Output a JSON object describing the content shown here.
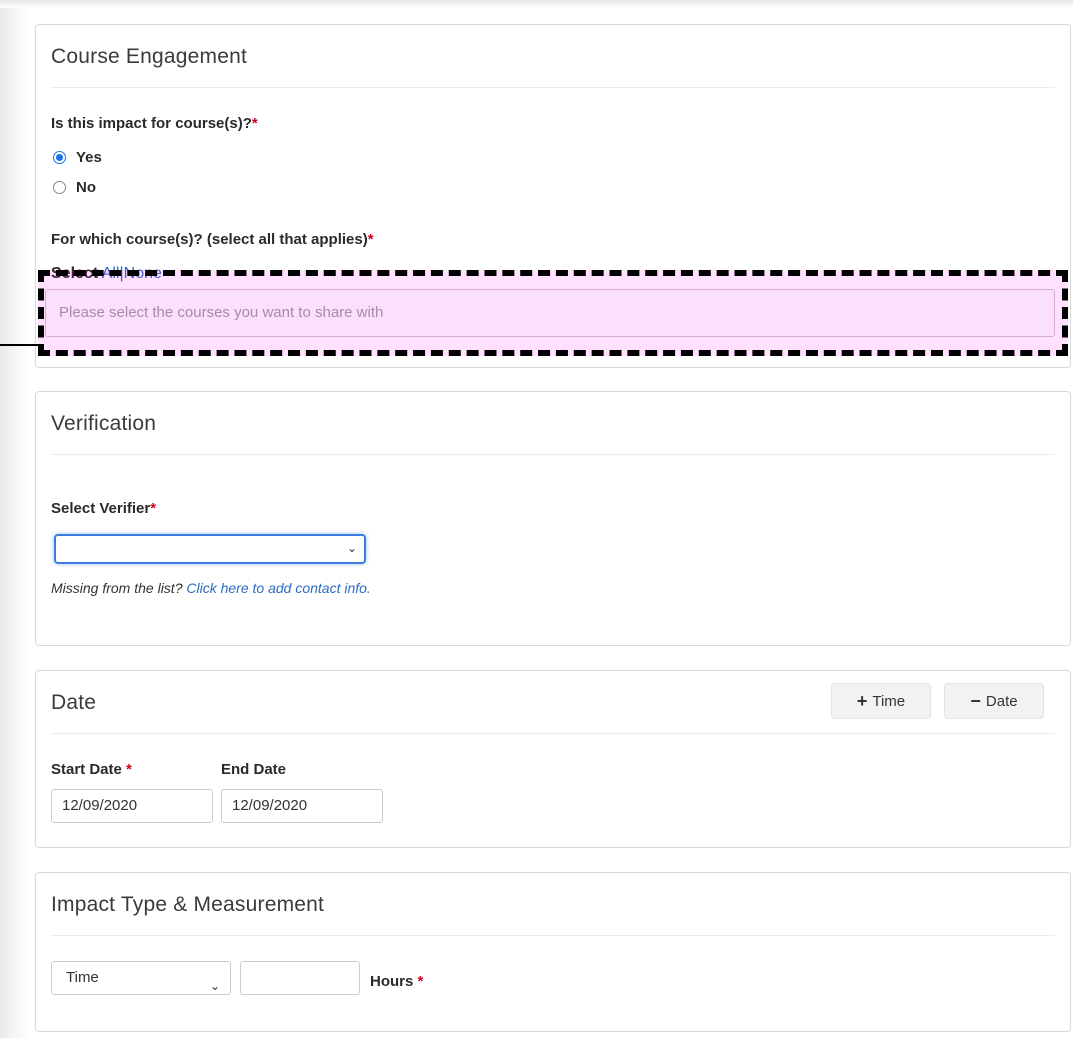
{
  "course_engagement": {
    "title": "Course Engagement",
    "question": "Is this impact for course(s)?",
    "required_mark": "*",
    "options": [
      {
        "label": "Yes",
        "checked": true
      },
      {
        "label": "No",
        "checked": false
      }
    ],
    "courses_question": "For which course(s)? (select all that applies)",
    "select_prefix": "Select",
    "select_all": "All",
    "select_separator": "|",
    "select_none": "None",
    "courses_placeholder": "Please select the courses you want to share with"
  },
  "verification": {
    "title": "Verification",
    "verifier_label": "Select Verifier",
    "required_mark": "*",
    "selected_verifier": "",
    "helper_text": "Missing from the list?",
    "helper_link": "Click here to add contact info."
  },
  "date": {
    "title": "Date",
    "add_time_label": "Time",
    "remove_date_label": "Date",
    "start_label": "Start Date",
    "required_mark": "*",
    "end_label": "End Date",
    "start_value": "12/09/2020",
    "end_value": "12/09/2020"
  },
  "impact": {
    "title": "Impact Type & Measurement",
    "type_value": "Time",
    "amount_value": "",
    "unit_label": "Hours",
    "required_mark": "*"
  },
  "colors": {
    "link": "#2b6cc4",
    "required": "#d0021b",
    "highlight_fill": "#fbe0fb",
    "radio_selected": "#1a73e8"
  },
  "icons": {
    "chevron": "chevron-down-icon",
    "plus": "plus-icon",
    "minus": "minus-icon"
  }
}
